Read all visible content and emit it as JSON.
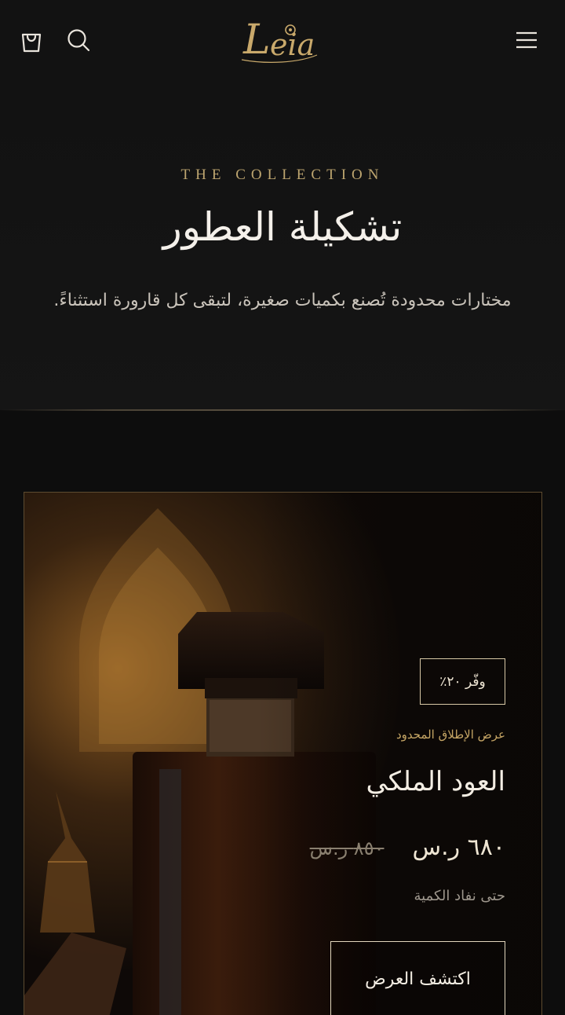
{
  "header": {
    "logo_text": "Leia",
    "cart_icon": "cart-icon",
    "search_icon": "search-icon",
    "menu_icon": "hamburger-menu-icon"
  },
  "hero": {
    "eyebrow": "THE COLLECTION",
    "title": "تشكيلة العطور",
    "subtitle": "مختارات محدودة تُصنع بكميات صغيرة، لتبقى كل قارورة استثناءً."
  },
  "product_card": {
    "badge": "وفّر ٢٠٪",
    "offer_label": "عرض الإطلاق المحدود",
    "name": "العود الملكي",
    "price_new": "٦٨٠ ر.س",
    "price_old": "٨٥٠ ر.س",
    "stock_note": "حتى نفاد الكمية",
    "cta_label": "اكتشف العرض"
  },
  "colors": {
    "background": "#0d0d0d",
    "accent_gold": "#bda56f",
    "card_border": "#5d4b30"
  }
}
